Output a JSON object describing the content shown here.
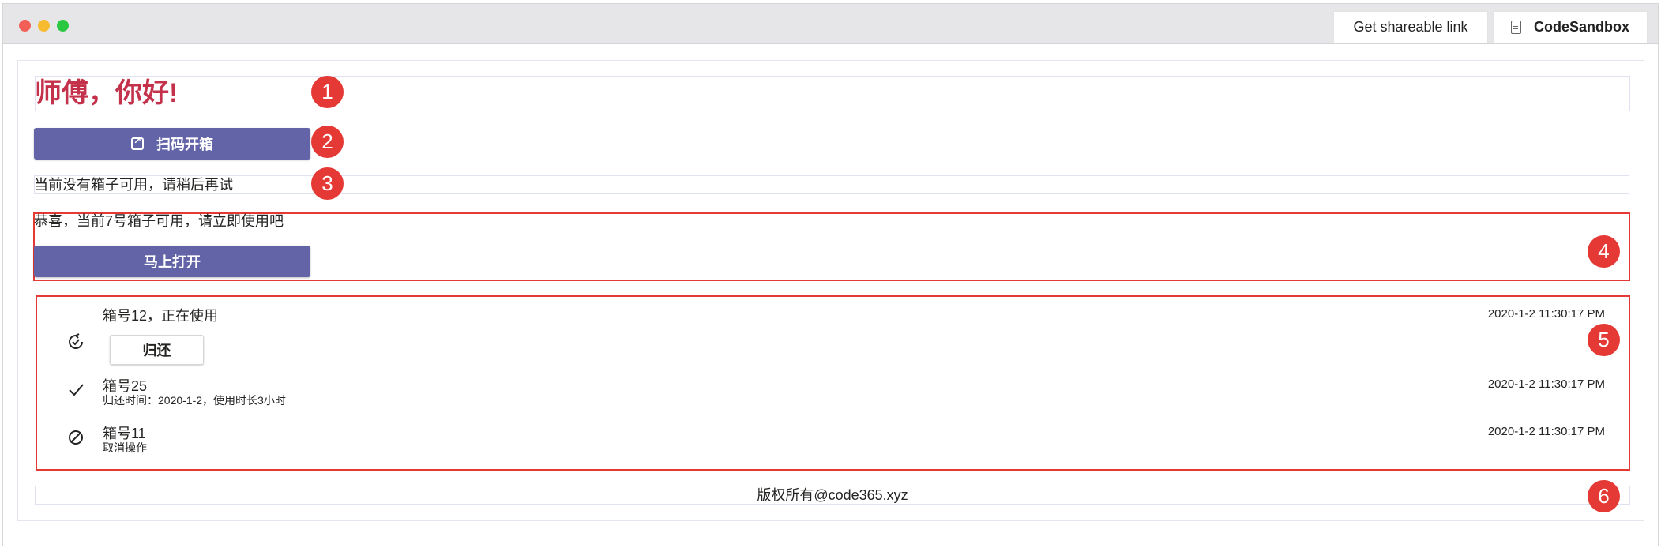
{
  "toolbar": {
    "share_label": "Get shareable link",
    "codesandbox_label": "CodeSandbox"
  },
  "greeting": "师傅，你好!",
  "scan_button_label": "扫码开箱",
  "no_box_message": "当前没有箱子可用，请稍后再试",
  "available_message": "恭喜，当前7号箱子可用，请立即使用吧",
  "open_button_label": "马上打开",
  "records": [
    {
      "title": "箱号12，正在使用",
      "subtitle": "",
      "time": "2020-1-2 11:30:17 PM",
      "icon": "in-progress-icon",
      "action_label": "归还"
    },
    {
      "title": "箱号25",
      "subtitle": "归还时间：2020-1-2，使用时长3小时",
      "time": "2020-1-2 11:30:17 PM",
      "icon": "check-icon"
    },
    {
      "title": "箱号11",
      "subtitle": "取消操作",
      "time": "2020-1-2 11:30:17 PM",
      "icon": "ban-icon"
    }
  ],
  "footer": "版权所有@code365.xyz",
  "annotations": [
    "1",
    "2",
    "3",
    "4",
    "5",
    "6"
  ],
  "colors": {
    "brand": "#6264a7",
    "greeting": "#c4314b",
    "annotation": "#e53935"
  }
}
